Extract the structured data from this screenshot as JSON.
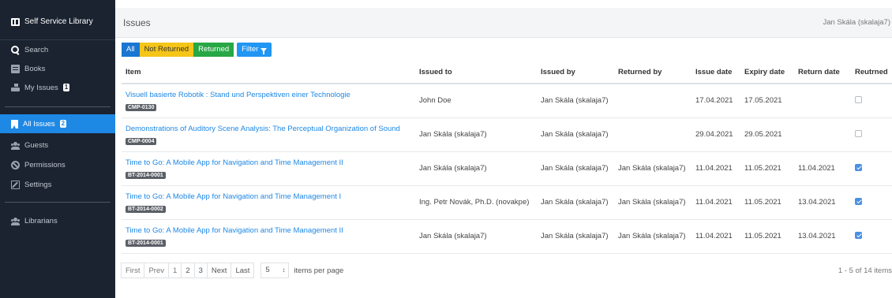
{
  "sidebar": {
    "app_title": "Self Service Library",
    "items": [
      {
        "label": "Search",
        "icon": "search-icon"
      },
      {
        "label": "Books",
        "icon": "book-icon"
      },
      {
        "label": "My Issues",
        "badge": "1",
        "icon": "hand-icon"
      },
      {
        "label": "All Issues",
        "badge": "2",
        "icon": "bookmark-icon"
      },
      {
        "label": "Guests",
        "icon": "users-icon"
      },
      {
        "label": "Permissions",
        "icon": "ban-icon"
      },
      {
        "label": "Settings",
        "icon": "edit-icon"
      },
      {
        "label": "Librarians",
        "icon": "users-icon"
      }
    ]
  },
  "header": {
    "title": "Issues",
    "user": "Jan Skála (skalaja7)"
  },
  "filters": {
    "all": "All",
    "not_returned": "Not Returned",
    "returned": "Returned",
    "filter": "Filter"
  },
  "table": {
    "columns": [
      "Item",
      "Issued to",
      "Issued by",
      "Returned by",
      "Issue date",
      "Expiry date",
      "Return date",
      "Reutrned"
    ],
    "rows": [
      {
        "title": "Visuell basierte Robotik : Stand und Perspektiven einer Technologie",
        "code": "CMP-0130",
        "issued_to": "John Doe",
        "issued_by": "Jan Skála (skalaja7)",
        "returned_by": "",
        "issue_date": "17.04.2021",
        "expiry_date": "17.05.2021",
        "return_date": "",
        "returned": false
      },
      {
        "title": "Demonstrations of Auditory Scene Analysis: The Perceptual Organization of Sound",
        "code": "CMP-0004",
        "issued_to": "Jan Skála (skalaja7)",
        "issued_by": "Jan Skála (skalaja7)",
        "returned_by": "",
        "issue_date": "29.04.2021",
        "expiry_date": "29.05.2021",
        "return_date": "",
        "returned": false
      },
      {
        "title": "Time to Go: A Mobile App for Navigation and Time Management II",
        "code": "BT-2014-0001",
        "issued_to": "Jan Skála (skalaja7)",
        "issued_by": "Jan Skála (skalaja7)",
        "returned_by": "Jan Skála (skalaja7)",
        "issue_date": "11.04.2021",
        "expiry_date": "11.05.2021",
        "return_date": "11.04.2021",
        "returned": true
      },
      {
        "title": "Time to Go: A Mobile App for Navigation and Time Management I",
        "code": "BT-2014-0002",
        "issued_to": "Ing. Petr Novák, Ph.D. (novakpe)",
        "issued_by": "Jan Skála (skalaja7)",
        "returned_by": "Jan Skála (skalaja7)",
        "issue_date": "11.04.2021",
        "expiry_date": "11.05.2021",
        "return_date": "13.04.2021",
        "returned": true
      },
      {
        "title": "Time to Go: A Mobile App for Navigation and Time Management II",
        "code": "BT-2014-0001",
        "issued_to": "Jan Skála (skalaja7)",
        "issued_by": "Jan Skála (skalaja7)",
        "returned_by": "Jan Skála (skalaja7)",
        "issue_date": "11.04.2021",
        "expiry_date": "11.05.2021",
        "return_date": "13.04.2021",
        "returned": true
      }
    ]
  },
  "pagination": {
    "first": "First",
    "prev": "Prev",
    "pages": [
      "1",
      "2",
      "3"
    ],
    "next": "Next",
    "last": "Last",
    "per_page": "5",
    "per_page_label": "items per page",
    "range": "1 - 5 of 14 items"
  }
}
